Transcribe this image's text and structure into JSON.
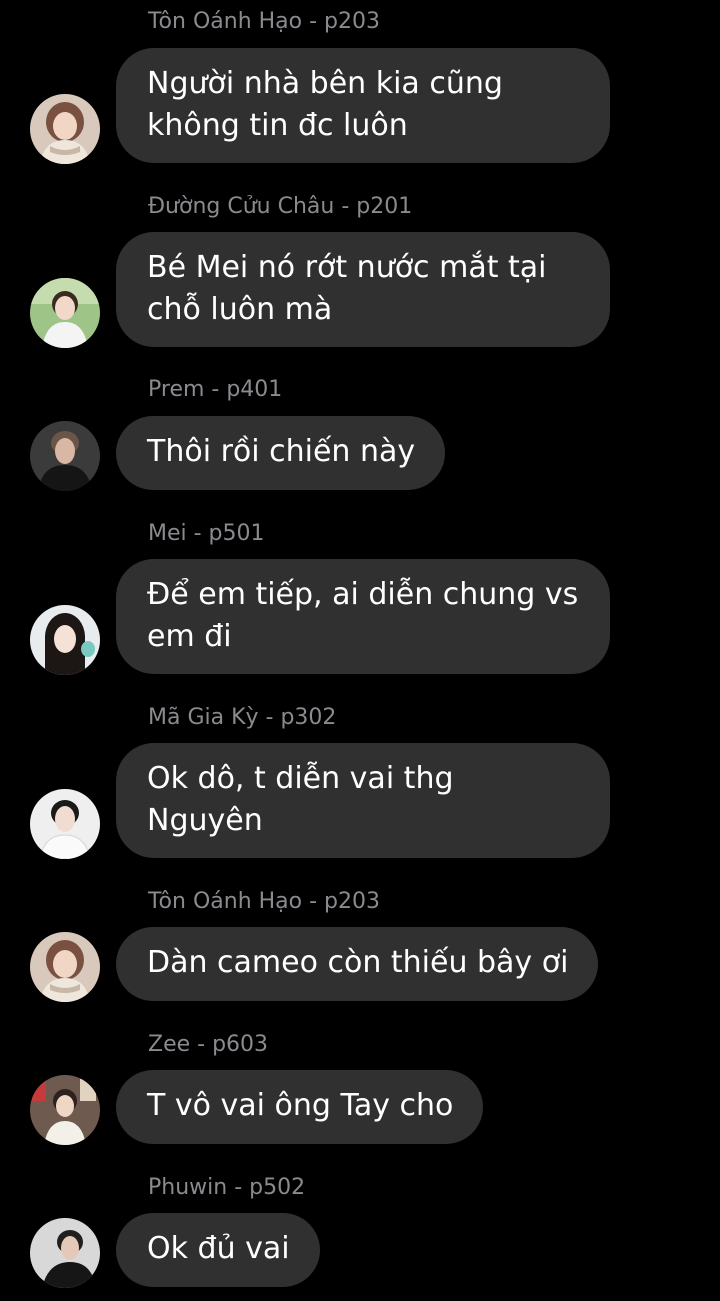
{
  "messages": [
    {
      "sender": "Tôn Oánh Hạo - p203",
      "lines": [
        "Người nhà bên kia cũng",
        "không tin đc luôn"
      ],
      "avatar": "girl-cream-scarf-avatar"
    },
    {
      "sender": "Đường Cửu Châu - p201",
      "lines": [
        "Bé Mei nó rớt nước mắt tại",
        "chỗ luôn mà"
      ],
      "avatar": "boy-white-outdoor-avatar"
    },
    {
      "sender": "Prem - p401",
      "lines": [
        "Thôi rồi chiến này"
      ],
      "avatar": "man-dark-jacket-avatar"
    },
    {
      "sender": "Mei - p501",
      "lines": [
        "Để em tiếp, ai diễn chung vs",
        "em đi"
      ],
      "avatar": "girl-long-hair-avatar"
    },
    {
      "sender": "Mã Gia Kỳ - p302",
      "lines": [
        "Ok dô, t diễn vai thg",
        "Nguyên"
      ],
      "avatar": "boy-white-shirt-avatar"
    },
    {
      "sender": "Tôn Oánh Hạo - p203",
      "lines": [
        "Dàn cameo còn thiếu bây ơi"
      ],
      "avatar": "girl-cream-scarf-avatar"
    },
    {
      "sender": "Zee - p603",
      "lines": [
        "T vô vai ông Tay cho"
      ],
      "avatar": "boy-bright-room-avatar"
    },
    {
      "sender": "Phuwin - p502",
      "lines": [
        "Ok đủ vai"
      ],
      "avatar": "man-dark-suit-avatar"
    }
  ],
  "colors": {
    "background": "#000000",
    "bubble": "#303030",
    "bubble_text": "#ffffff",
    "sender_text": "#8a8a8f"
  }
}
